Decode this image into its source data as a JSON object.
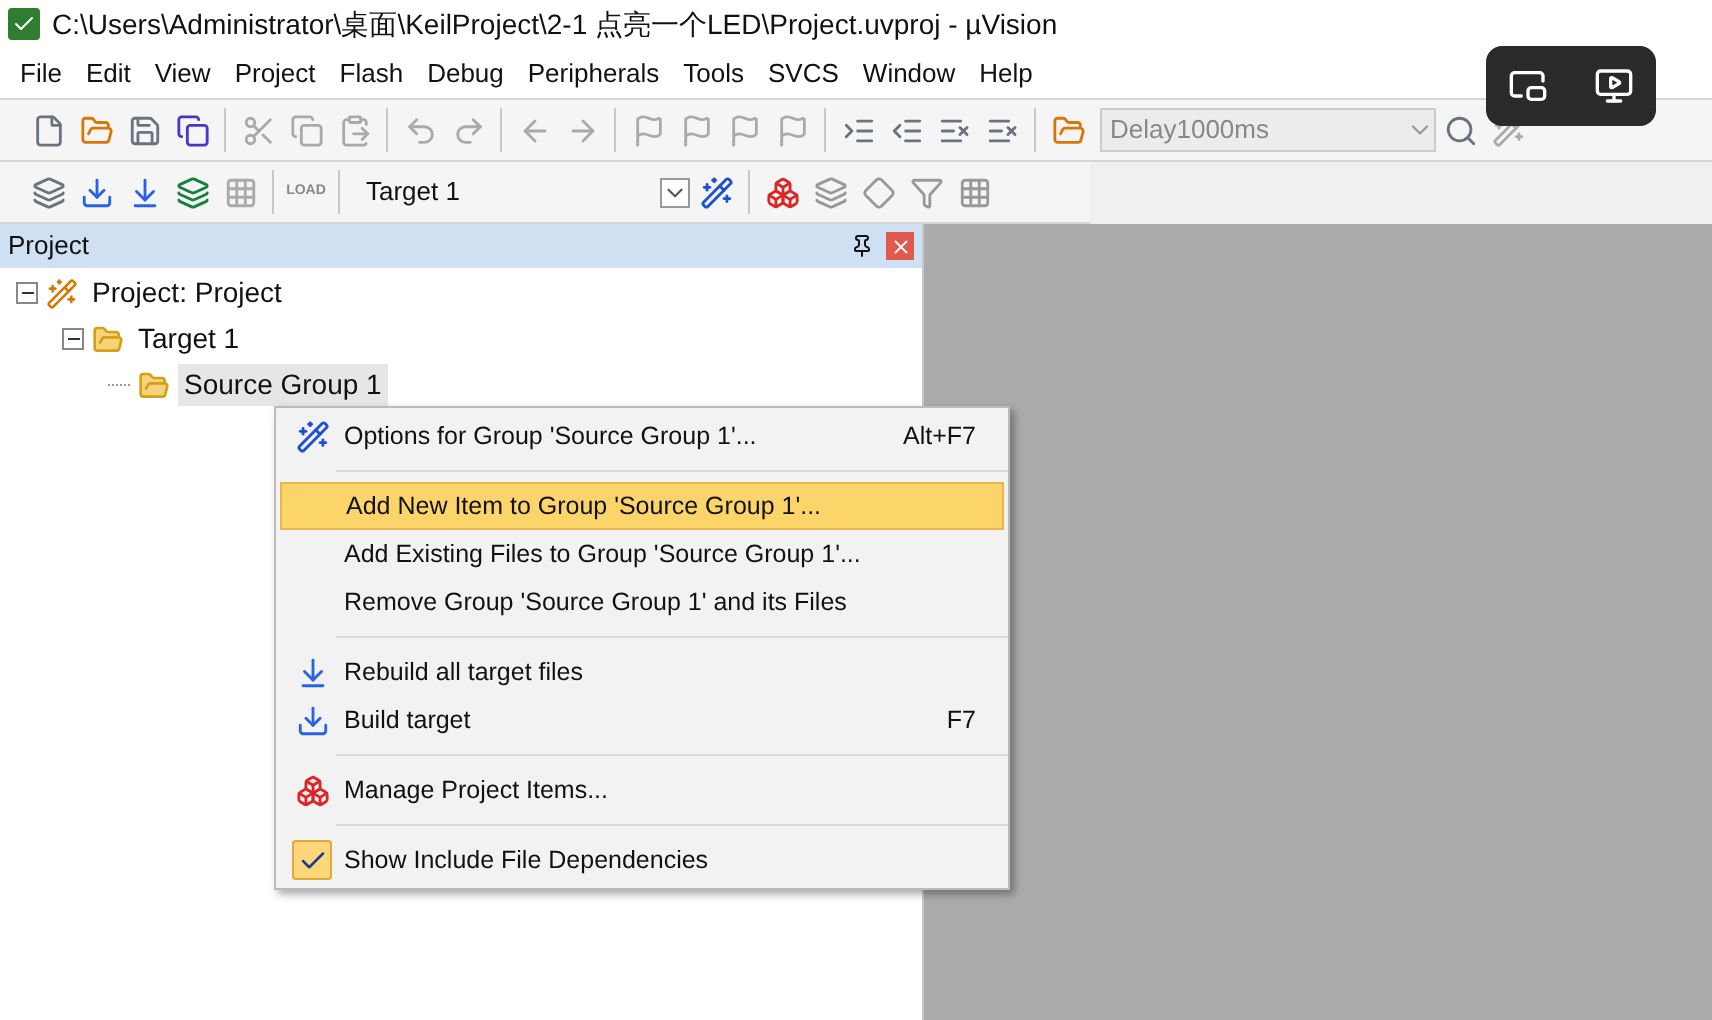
{
  "window": {
    "title": "C:\\Users\\Administrator\\桌面\\KeilProject\\2-1 点亮一个LED\\Project.uvproj - µVision"
  },
  "menu_bar": [
    "File",
    "Edit",
    "View",
    "Project",
    "Flash",
    "Debug",
    "Peripherals",
    "Tools",
    "SVCS",
    "Window",
    "Help"
  ],
  "toolbar": {
    "find_combo": {
      "value": "Delay1000ms",
      "disabled": true
    }
  },
  "build_toolbar": {
    "load_label": "LOAD",
    "target_select": {
      "value": "Target 1"
    }
  },
  "project_panel": {
    "title": "Project",
    "tree": [
      {
        "label": "Project: Project",
        "expanded": true,
        "children": [
          {
            "label": "Target 1",
            "expanded": true,
            "children": [
              {
                "label": "Source Group 1",
                "selected": true
              }
            ]
          }
        ]
      }
    ]
  },
  "context_menu": [
    {
      "kind": "item",
      "label": "Options for Group 'Source Group 1'...",
      "shortcut": "Alt+F7",
      "selected": false
    },
    {
      "kind": "separator"
    },
    {
      "kind": "item",
      "label": "Add New  Item to Group 'Source Group 1'...",
      "selected": true
    },
    {
      "kind": "item",
      "label": "Add Existing Files to Group 'Source Group 1'...",
      "selected": false
    },
    {
      "kind": "item",
      "label": "Remove Group 'Source Group 1' and its Files",
      "selected": false
    },
    {
      "kind": "separator"
    },
    {
      "kind": "item",
      "label": "Rebuild all target files",
      "selected": false
    },
    {
      "kind": "item",
      "label": "Build target",
      "shortcut": "F7",
      "selected": false
    },
    {
      "kind": "separator"
    },
    {
      "kind": "item",
      "label": "Manage Project Items...",
      "selected": false
    },
    {
      "kind": "separator"
    },
    {
      "kind": "item",
      "label": "Show Include File Dependencies",
      "checked": true,
      "selected": false
    }
  ]
}
